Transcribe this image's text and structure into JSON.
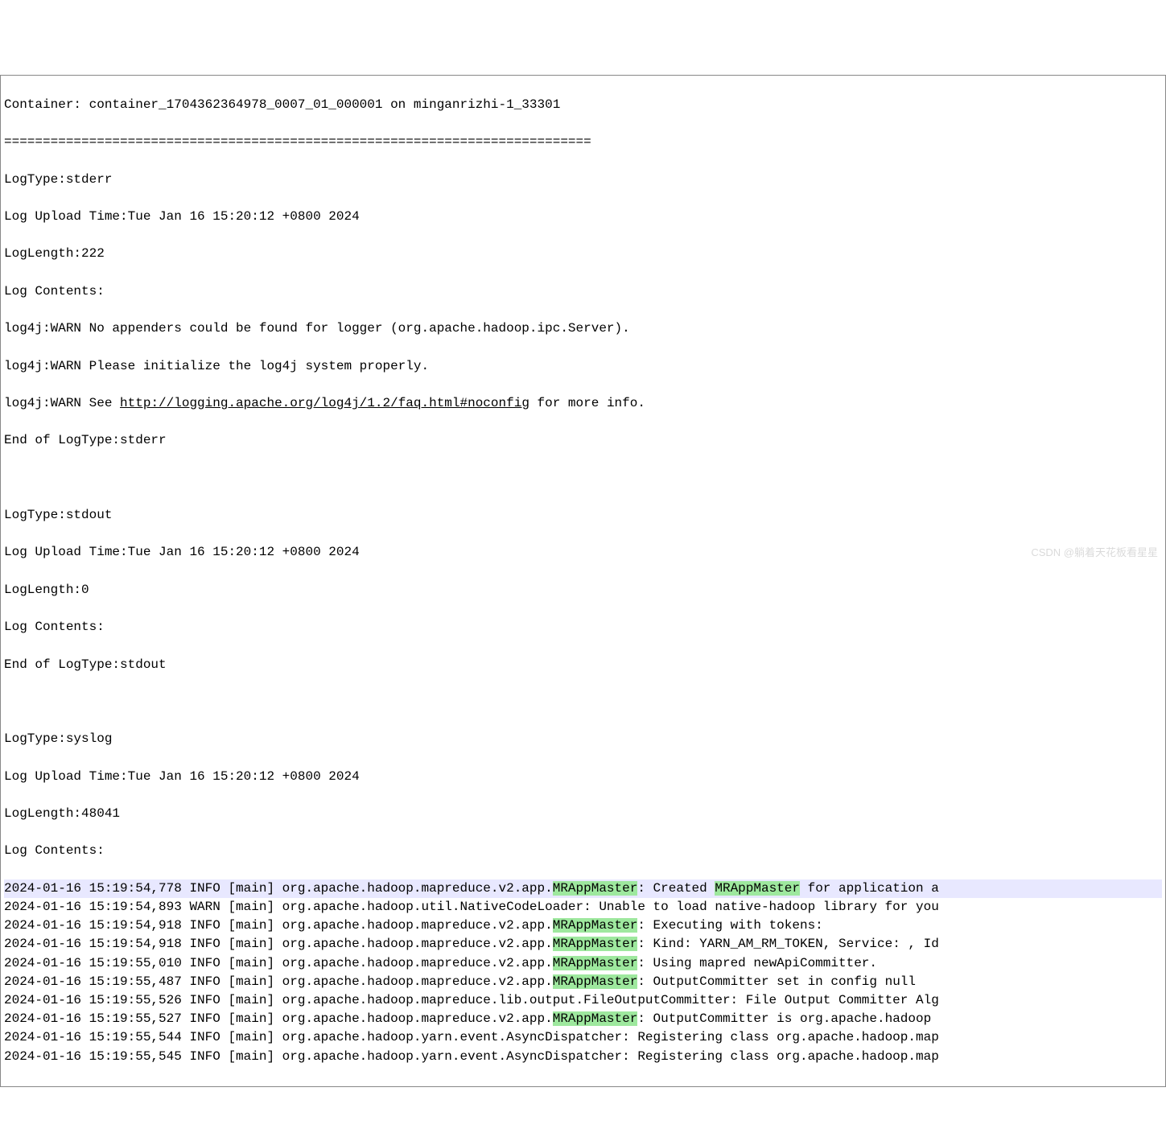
{
  "header": {
    "containerLine": "Container: container_1704362364978_0007_01_000001 on minganrizhi-1_33301",
    "divider": "============================================================================"
  },
  "stderr": {
    "logType": "LogType:stderr",
    "uploadTime": "Log Upload Time:Tue Jan 16 15:20:12 +0800 2024",
    "logLength": "LogLength:222",
    "logContents": "Log Contents:",
    "l1": "log4j:WARN No appenders could be found for logger (org.apache.hadoop.ipc.Server).",
    "l2": "log4j:WARN Please initialize the log4j system properly.",
    "l3a": "log4j:WARN See ",
    "l3link": "http://logging.apache.org/log4j/1.2/faq.html#noconfig",
    "l3b": " for more info.",
    "end": "End of LogType:stderr"
  },
  "stdout": {
    "logType": "LogType:stdout",
    "uploadTime": "Log Upload Time:Tue Jan 16 15:20:12 +0800 2024",
    "logLength": "LogLength:0",
    "logContents": "Log Contents:",
    "end": "End of LogType:stdout"
  },
  "syslog": {
    "logType": "LogType:syslog",
    "uploadTime": "Log Upload Time:Tue Jan 16 15:20:12 +0800 2024",
    "logLength": "LogLength:48041",
    "logContents": "Log Contents:",
    "highlight": "MRAppMaster",
    "rows": [
      {
        "ts": "2024-01-16 15:19:54,778",
        "lvl": "INFO",
        "th": "[main]",
        "prefix": "org.apache.hadoop.mapreduce.v2.app.",
        "cls": "MRAppMaster",
        "mid": ": Created ",
        "cls2": "MRAppMaster",
        "tail": " for application a",
        "hlRow": true
      },
      {
        "ts": "2024-01-16 15:19:54,893",
        "lvl": "WARN",
        "th": "[main]",
        "prefix": "org.apache.hadoop.util.NativeCodeLoader: Unable to load native-hadoop library for you",
        "cls": "",
        "mid": "",
        "cls2": "",
        "tail": ""
      },
      {
        "ts": "2024-01-16 15:19:54,918",
        "lvl": "INFO",
        "th": "[main]",
        "prefix": "org.apache.hadoop.mapreduce.v2.app.",
        "cls": "MRAppMaster",
        "mid": ": Executing with tokens:",
        "cls2": "",
        "tail": ""
      },
      {
        "ts": "2024-01-16 15:19:54,918",
        "lvl": "INFO",
        "th": "[main]",
        "prefix": "org.apache.hadoop.mapreduce.v2.app.",
        "cls": "MRAppMaster",
        "mid": ": Kind: YARN_AM_RM_TOKEN, Service: , Id",
        "cls2": "",
        "tail": ""
      },
      {
        "ts": "2024-01-16 15:19:55,010",
        "lvl": "INFO",
        "th": "[main]",
        "prefix": "org.apache.hadoop.mapreduce.v2.app.",
        "cls": "MRAppMaster",
        "mid": ": Using mapred newApiCommitter.",
        "cls2": "",
        "tail": ""
      },
      {
        "ts": "2024-01-16 15:19:55,487",
        "lvl": "INFO",
        "th": "[main]",
        "prefix": "org.apache.hadoop.mapreduce.v2.app.",
        "cls": "MRAppMaster",
        "mid": ": OutputCommitter set in config null",
        "cls2": "",
        "tail": ""
      },
      {
        "ts": "2024-01-16 15:19:55,526",
        "lvl": "INFO",
        "th": "[main]",
        "prefix": "org.apache.hadoop.mapreduce.lib.output.FileOutputCommitter: File Output Committer Alg",
        "cls": "",
        "mid": "",
        "cls2": "",
        "tail": ""
      },
      {
        "ts": "2024-01-16 15:19:55,527",
        "lvl": "INFO",
        "th": "[main]",
        "prefix": "org.apache.hadoop.mapreduce.v2.app.",
        "cls": "MRAppMaster",
        "mid": ": OutputCommitter is org.apache.hadoop",
        "cls2": "",
        "tail": ""
      },
      {
        "ts": "2024-01-16 15:19:55,544",
        "lvl": "INFO",
        "th": "[main]",
        "prefix": "org.apache.hadoop.yarn.event.AsyncDispatcher: Registering class org.apache.hadoop.map",
        "cls": "",
        "mid": "",
        "cls2": "",
        "tail": ""
      },
      {
        "ts": "2024-01-16 15:19:55,545",
        "lvl": "INFO",
        "th": "[main]",
        "prefix": "org.apache.hadoop.yarn.event.AsyncDispatcher: Registering class org.apache.hadoop.map",
        "cls": "",
        "mid": "",
        "cls2": "",
        "tail": ""
      }
    ]
  },
  "watermark": "CSDN @躺着天花板看星星"
}
